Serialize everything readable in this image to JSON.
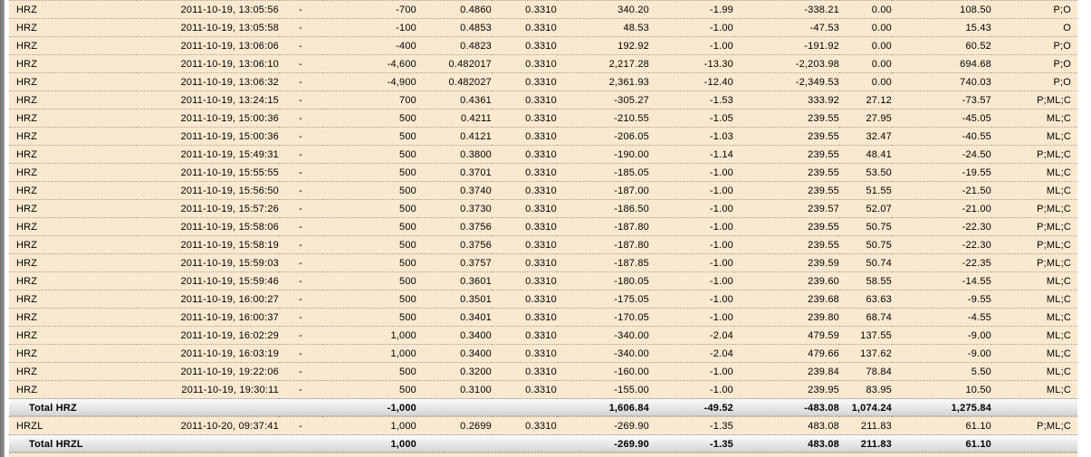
{
  "colors": {
    "row_bg": "#fae9cf",
    "separator": "#a9a097",
    "total_bar_top": "#fbfbfb",
    "total_bar_bottom": "#d2d2d2",
    "window_edge": "#6e6e6e",
    "text": "#000000"
  },
  "table": {
    "rows": [
      {
        "type": "data",
        "cells": [
          "HRZ",
          "2011-10-19, 13:05:56",
          "-",
          "-700",
          "0.4860",
          "0.3310",
          "340.20",
          "-1.99",
          "-338.21",
          "0.00",
          "108.50",
          "P;O"
        ]
      },
      {
        "type": "data",
        "cells": [
          "HRZ",
          "2011-10-19, 13:05:58",
          "-",
          "-100",
          "0.4853",
          "0.3310",
          "48.53",
          "-1.00",
          "-47.53",
          "0.00",
          "15.43",
          "O"
        ]
      },
      {
        "type": "data",
        "cells": [
          "HRZ",
          "2011-10-19, 13:06:06",
          "-",
          "-400",
          "0.4823",
          "0.3310",
          "192.92",
          "-1.00",
          "-191.92",
          "0.00",
          "60.52",
          "P;O"
        ]
      },
      {
        "type": "data",
        "cells": [
          "HRZ",
          "2011-10-19, 13:06:10",
          "-",
          "-4,600",
          "0.482017",
          "0.3310",
          "2,217.28",
          "-13.30",
          "-2,203.98",
          "0.00",
          "694.68",
          "P;O"
        ]
      },
      {
        "type": "data",
        "cells": [
          "HRZ",
          "2011-10-19, 13:06:32",
          "-",
          "-4,900",
          "0.482027",
          "0.3310",
          "2,361.93",
          "-12.40",
          "-2,349.53",
          "0.00",
          "740.03",
          "P;O"
        ]
      },
      {
        "type": "data",
        "cells": [
          "HRZ",
          "2011-10-19, 13:24:15",
          "-",
          "700",
          "0.4361",
          "0.3310",
          "-305.27",
          "-1.53",
          "333.92",
          "27.12",
          "-73.57",
          "P;ML;C"
        ]
      },
      {
        "type": "data",
        "cells": [
          "HRZ",
          "2011-10-19, 15:00:36",
          "-",
          "500",
          "0.4211",
          "0.3310",
          "-210.55",
          "-1.05",
          "239.55",
          "27.95",
          "-45.05",
          "ML;C"
        ]
      },
      {
        "type": "data",
        "cells": [
          "HRZ",
          "2011-10-19, 15:00:36",
          "-",
          "500",
          "0.4121",
          "0.3310",
          "-206.05",
          "-1.03",
          "239.55",
          "32.47",
          "-40.55",
          "ML;C"
        ]
      },
      {
        "type": "data",
        "cells": [
          "HRZ",
          "2011-10-19, 15:49:31",
          "-",
          "500",
          "0.3800",
          "0.3310",
          "-190.00",
          "-1.14",
          "239.55",
          "48.41",
          "-24.50",
          "P;ML;C"
        ]
      },
      {
        "type": "data",
        "cells": [
          "HRZ",
          "2011-10-19, 15:55:55",
          "-",
          "500",
          "0.3701",
          "0.3310",
          "-185.05",
          "-1.00",
          "239.55",
          "53.50",
          "-19.55",
          "ML;C"
        ]
      },
      {
        "type": "data",
        "cells": [
          "HRZ",
          "2011-10-19, 15:56:50",
          "-",
          "500",
          "0.3740",
          "0.3310",
          "-187.00",
          "-1.00",
          "239.55",
          "51.55",
          "-21.50",
          "ML;C"
        ]
      },
      {
        "type": "data",
        "cells": [
          "HRZ",
          "2011-10-19, 15:57:26",
          "-",
          "500",
          "0.3730",
          "0.3310",
          "-186.50",
          "-1.00",
          "239.57",
          "52.07",
          "-21.00",
          "P;ML;C"
        ]
      },
      {
        "type": "data",
        "cells": [
          "HRZ",
          "2011-10-19, 15:58:06",
          "-",
          "500",
          "0.3756",
          "0.3310",
          "-187.80",
          "-1.00",
          "239.55",
          "50.75",
          "-22.30",
          "P;ML;C"
        ]
      },
      {
        "type": "data",
        "cells": [
          "HRZ",
          "2011-10-19, 15:58:19",
          "-",
          "500",
          "0.3756",
          "0.3310",
          "-187.80",
          "-1.00",
          "239.55",
          "50.75",
          "-22.30",
          "P;ML;C"
        ]
      },
      {
        "type": "data",
        "cells": [
          "HRZ",
          "2011-10-19, 15:59:03",
          "-",
          "500",
          "0.3757",
          "0.3310",
          "-187.85",
          "-1.00",
          "239.59",
          "50.74",
          "-22.35",
          "P;ML;C"
        ]
      },
      {
        "type": "data",
        "cells": [
          "HRZ",
          "2011-10-19, 15:59:46",
          "-",
          "500",
          "0.3601",
          "0.3310",
          "-180.05",
          "-1.00",
          "239.60",
          "58.55",
          "-14.55",
          "ML;C"
        ]
      },
      {
        "type": "data",
        "cells": [
          "HRZ",
          "2011-10-19, 16:00:27",
          "-",
          "500",
          "0.3501",
          "0.3310",
          "-175.05",
          "-1.00",
          "239.68",
          "63.63",
          "-9.55",
          "ML;C"
        ]
      },
      {
        "type": "data",
        "cells": [
          "HRZ",
          "2011-10-19, 16:00:37",
          "-",
          "500",
          "0.3401",
          "0.3310",
          "-170.05",
          "-1.00",
          "239.80",
          "68.74",
          "-4.55",
          "ML;C"
        ]
      },
      {
        "type": "data",
        "cells": [
          "HRZ",
          "2011-10-19, 16:02:29",
          "-",
          "1,000",
          "0.3400",
          "0.3310",
          "-340.00",
          "-2.04",
          "479.59",
          "137.55",
          "-9.00",
          "ML;C"
        ]
      },
      {
        "type": "data",
        "cells": [
          "HRZ",
          "2011-10-19, 16:03:19",
          "-",
          "1,000",
          "0.3400",
          "0.3310",
          "-340.00",
          "-2.04",
          "479.66",
          "137.62",
          "-9.00",
          "ML;C"
        ]
      },
      {
        "type": "data",
        "cells": [
          "HRZ",
          "2011-10-19, 19:22:06",
          "-",
          "500",
          "0.3200",
          "0.3310",
          "-160.00",
          "-1.00",
          "239.84",
          "78.84",
          "5.50",
          "ML;C"
        ]
      },
      {
        "type": "data",
        "cells": [
          "HRZ",
          "2011-10-19, 19:30:11",
          "-",
          "500",
          "0.3100",
          "0.3310",
          "-155.00",
          "-1.00",
          "239.95",
          "83.95",
          "10.50",
          "ML;C"
        ]
      },
      {
        "type": "total",
        "cells": [
          "Total HRZ",
          "",
          "",
          "-1,000",
          "",
          "",
          "1,606.84",
          "-49.52",
          "-483.08",
          "1,074.24",
          "1,275.84",
          ""
        ]
      },
      {
        "type": "data",
        "cells": [
          "HRZL",
          "2011-10-20, 09:37:41",
          "-",
          "1,000",
          "0.2699",
          "0.3310",
          "-269.90",
          "-1.35",
          "483.08",
          "211.83",
          "61.10",
          "P;ML;C"
        ]
      },
      {
        "type": "total",
        "cells": [
          "Total HRZL",
          "",
          "",
          "1,000",
          "",
          "",
          "-269.90",
          "-1.35",
          "483.08",
          "211.83",
          "61.10",
          ""
        ]
      }
    ]
  }
}
